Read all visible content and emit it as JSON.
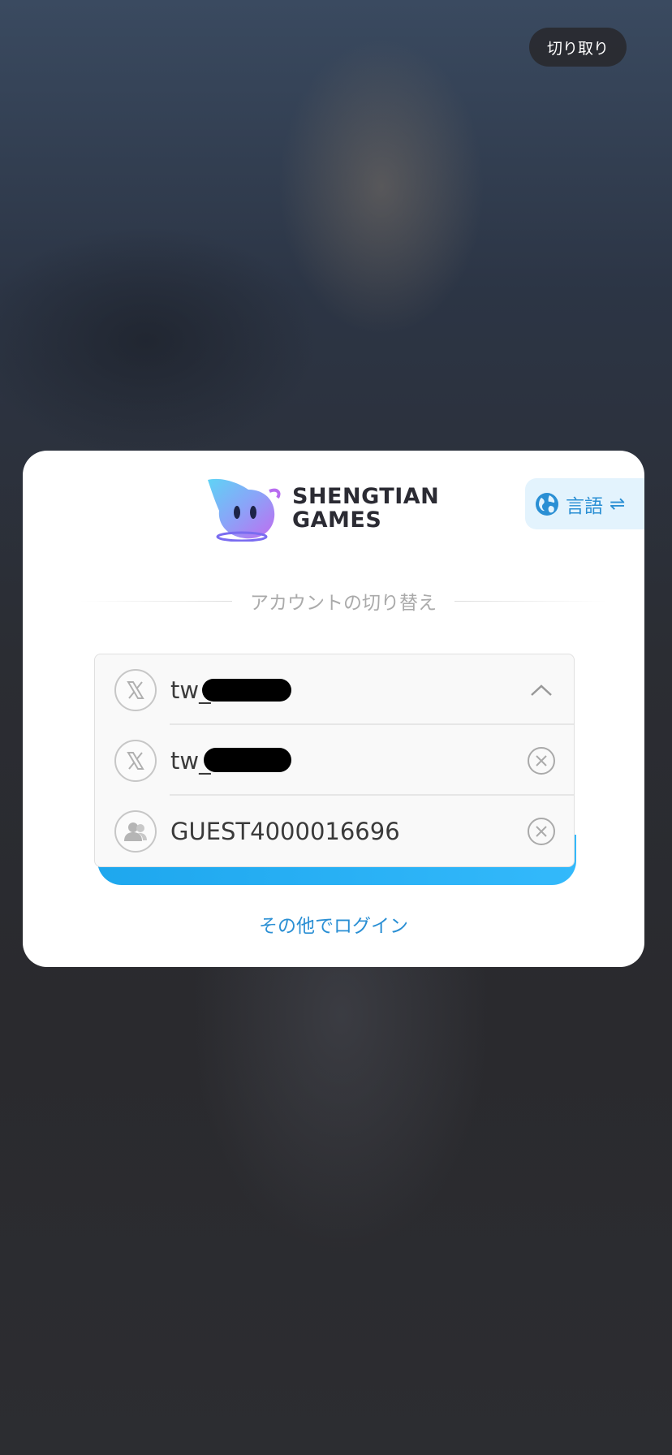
{
  "top_button": {
    "label": "切り取り"
  },
  "logo": {
    "line1": "SHENGTIAN",
    "line2": "GAMES"
  },
  "language": {
    "label": "言語",
    "swap_glyph": "⇌"
  },
  "section_title": "アカウントの切り替え",
  "accounts": [
    {
      "type": "x-icon",
      "name": "tw_",
      "action": "chevron-up-icon"
    },
    {
      "type": "x-icon",
      "name": "tw_",
      "action": "remove-icon"
    },
    {
      "type": "guest-icon",
      "name": "GUEST4000016696",
      "action": "remove-icon"
    }
  ],
  "other_login": "その他でログイン",
  "colors": {
    "accent": "#2a8fd4",
    "button": "#1ea7ee"
  }
}
